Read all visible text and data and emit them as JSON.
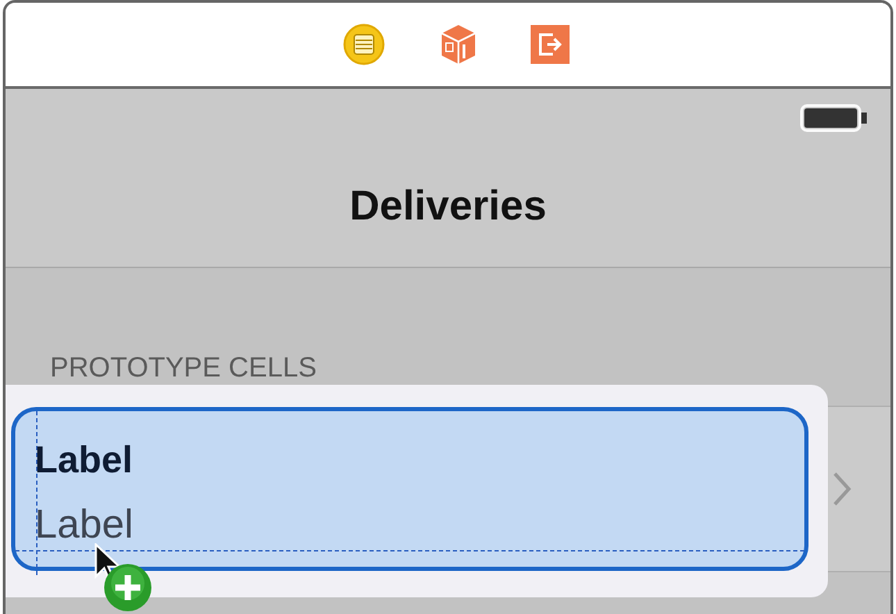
{
  "navigation_bar": {
    "title": "Deliveries"
  },
  "table": {
    "section_header": "PROTOTYPE CELLS"
  },
  "drag_preview": {
    "title": "Label",
    "subtitle": "Label"
  }
}
